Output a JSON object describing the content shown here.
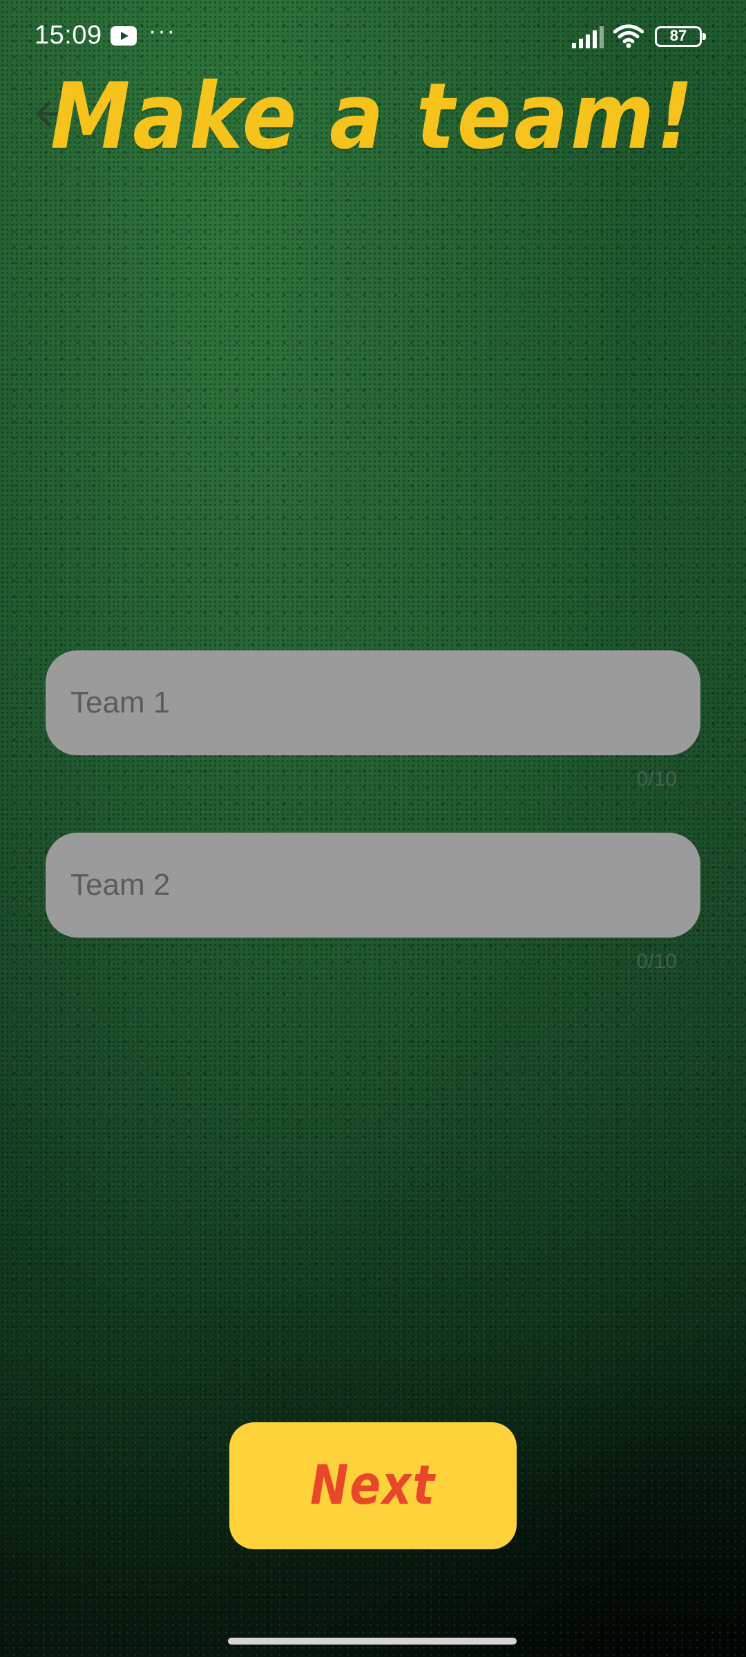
{
  "status_bar": {
    "time": "15:09",
    "more": "···",
    "battery": "87"
  },
  "header": {
    "title": "Make a team!",
    "back_icon": "arrow-left-icon"
  },
  "form": {
    "team1": {
      "placeholder": "Team 1",
      "value": "",
      "counter": "0/10"
    },
    "team2": {
      "placeholder": "Team 2",
      "value": "",
      "counter": "0/10"
    }
  },
  "actions": {
    "next_label": "Next"
  },
  "colors": {
    "title": "#f6c21c",
    "field_bg": "#9b9b9b",
    "button_bg": "#fdd23b",
    "button_text": "#e8482a"
  }
}
